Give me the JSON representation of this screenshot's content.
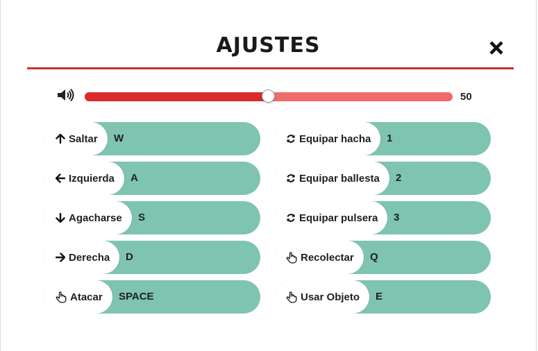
{
  "header": {
    "title": "AJUSTES",
    "close_icon": "close-icon"
  },
  "volume": {
    "icon": "volume-icon",
    "value": 50,
    "value_label": "50",
    "max": 100
  },
  "colors": {
    "accent_red": "#c9302c",
    "slider_fill": "#d92b2b",
    "slider_track": "#ef6b6b",
    "key_bg": "#7ec4b1"
  },
  "bindings": {
    "left": [
      {
        "icon": "arrow-up-icon",
        "action": "Saltar",
        "key": "W"
      },
      {
        "icon": "arrow-left-icon",
        "action": "Izquierda",
        "key": "A"
      },
      {
        "icon": "arrow-down-icon",
        "action": "Agacharse",
        "key": "S"
      },
      {
        "icon": "arrow-right-icon",
        "action": "Derecha",
        "key": "D"
      },
      {
        "icon": "hand-icon",
        "action": "Atacar",
        "key": "SPACE"
      }
    ],
    "right": [
      {
        "icon": "refresh-icon",
        "action": "Equipar hacha",
        "key": "1"
      },
      {
        "icon": "refresh-icon",
        "action": "Equipar ballesta",
        "key": "2"
      },
      {
        "icon": "refresh-icon",
        "action": "Equipar pulsera",
        "key": "3"
      },
      {
        "icon": "hand-icon",
        "action": "Recolectar",
        "key": "Q"
      },
      {
        "icon": "hand-icon",
        "action": "Usar Objeto",
        "key": "E"
      }
    ]
  }
}
